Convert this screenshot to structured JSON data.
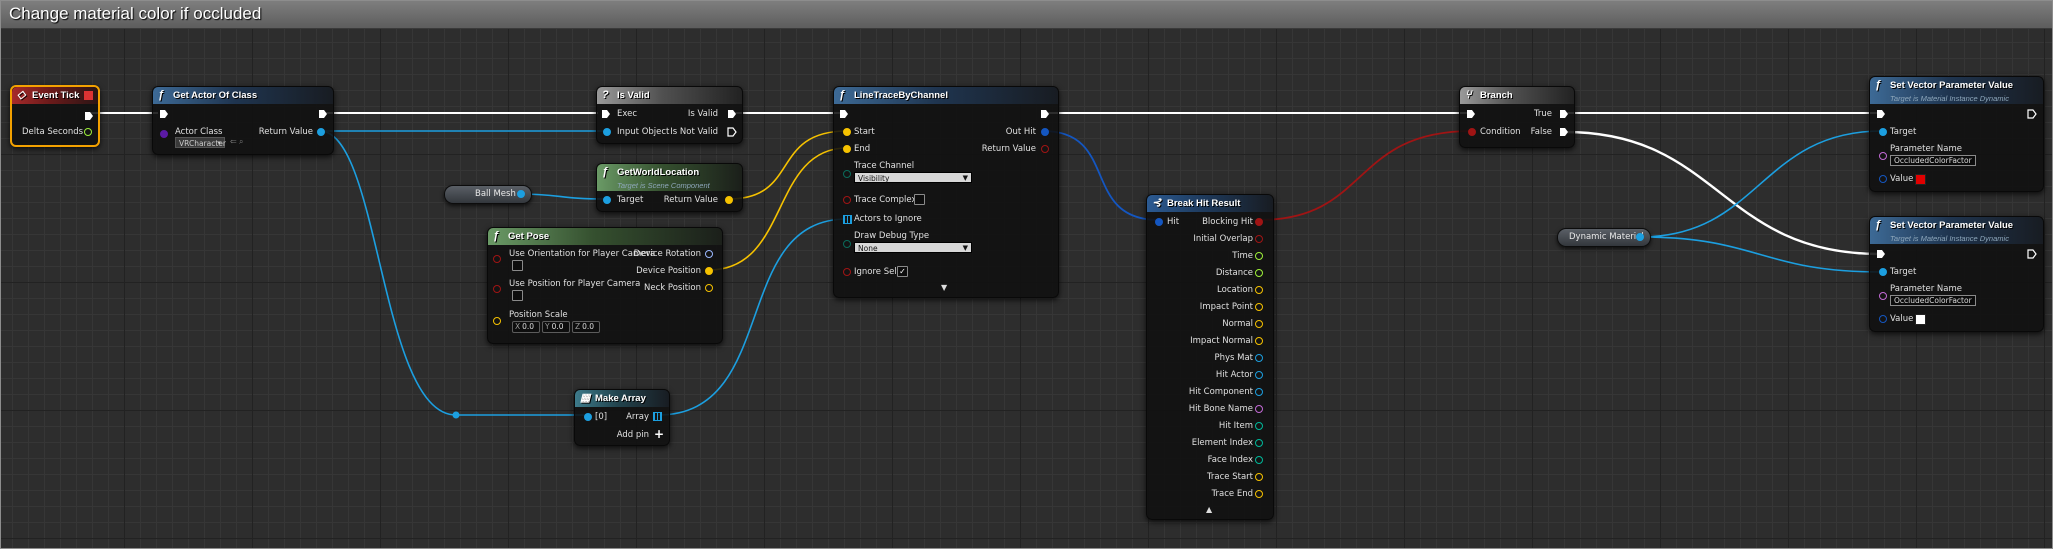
{
  "comment": {
    "title": "Change material color if occluded"
  },
  "colors": {
    "exec_wire": "#ffffff",
    "object_pin": "#1c9fe0",
    "vector_pin": "#f6c200",
    "bool_pin": "#a01414",
    "struct_pin": "#1456c0",
    "float_pin": "#9ef13a",
    "material_color": "#e00000",
    "white_color": "#ffffff"
  },
  "nodes": {
    "event_tick": {
      "title": "Event Tick",
      "out_delta": "Delta Seconds"
    },
    "get_actor_of_class": {
      "title": "Get Actor Of Class",
      "in_class": "Actor Class",
      "class_value": "VRCharacter",
      "out_return": "Return Value"
    },
    "is_valid": {
      "title": "Is Valid",
      "in_exec": "Exec",
      "in_object": "Input Object",
      "out_valid": "Is Valid",
      "out_not_valid": "Is Not Valid"
    },
    "ball_mesh": {
      "label": "Ball Mesh"
    },
    "get_world_location": {
      "title": "GetWorldLocation",
      "subtitle": "Target is Scene Component",
      "in_target": "Target",
      "out_return": "Return Value"
    },
    "get_pose": {
      "title": "Get Pose",
      "in_orientation": "Use Orientation for Player Camera",
      "in_position": "Use Position for Player Camera",
      "in_scale": "Position Scale",
      "scale_x": "0.0",
      "scale_y": "0.0",
      "scale_z": "0.0",
      "axis_x": "X",
      "axis_y": "Y",
      "axis_z": "Z",
      "out_rotation": "Device Rotation",
      "out_position": "Device Position",
      "out_neck": "Neck Position"
    },
    "make_array": {
      "title": "Make Array",
      "in_0": "[0]",
      "out_array": "Array",
      "add_pin": "Add pin"
    },
    "line_trace": {
      "title": "LineTraceByChannel",
      "in_start": "Start",
      "in_end": "End",
      "in_channel": "Trace Channel",
      "channel_value": "Visibility",
      "in_complex": "Trace Complex",
      "in_ignore": "Actors to Ignore",
      "in_debug": "Draw Debug Type",
      "debug_value": "None",
      "in_ignore_self": "Ignore Self",
      "out_hit": "Out Hit",
      "out_return": "Return Value"
    },
    "break_hit": {
      "title": "Break Hit Result",
      "in_hit": "Hit",
      "outputs": [
        "Blocking Hit",
        "Initial Overlap",
        "Time",
        "Distance",
        "Location",
        "Impact Point",
        "Normal",
        "Impact Normal",
        "Phys Mat",
        "Hit Actor",
        "Hit Component",
        "Hit Bone Name",
        "Hit Item",
        "Element Index",
        "Face Index",
        "Trace Start",
        "Trace End"
      ]
    },
    "branch": {
      "title": "Branch",
      "in_condition": "Condition",
      "out_true": "True",
      "out_false": "False"
    },
    "dynamic_material": {
      "label": "Dynamic Material"
    },
    "set_vector_1": {
      "title": "Set Vector Parameter Value",
      "subtitle": "Target is Material Instance Dynamic",
      "in_target": "Target",
      "in_param": "Parameter Name",
      "param_value": "OccludedColorFactor",
      "in_value": "Value"
    },
    "set_vector_2": {
      "title": "Set Vector Parameter Value",
      "subtitle": "Target is Material Instance Dynamic",
      "in_target": "Target",
      "in_param": "Parameter Name",
      "param_value": "OccludedColorFactor",
      "in_value": "Value"
    }
  }
}
